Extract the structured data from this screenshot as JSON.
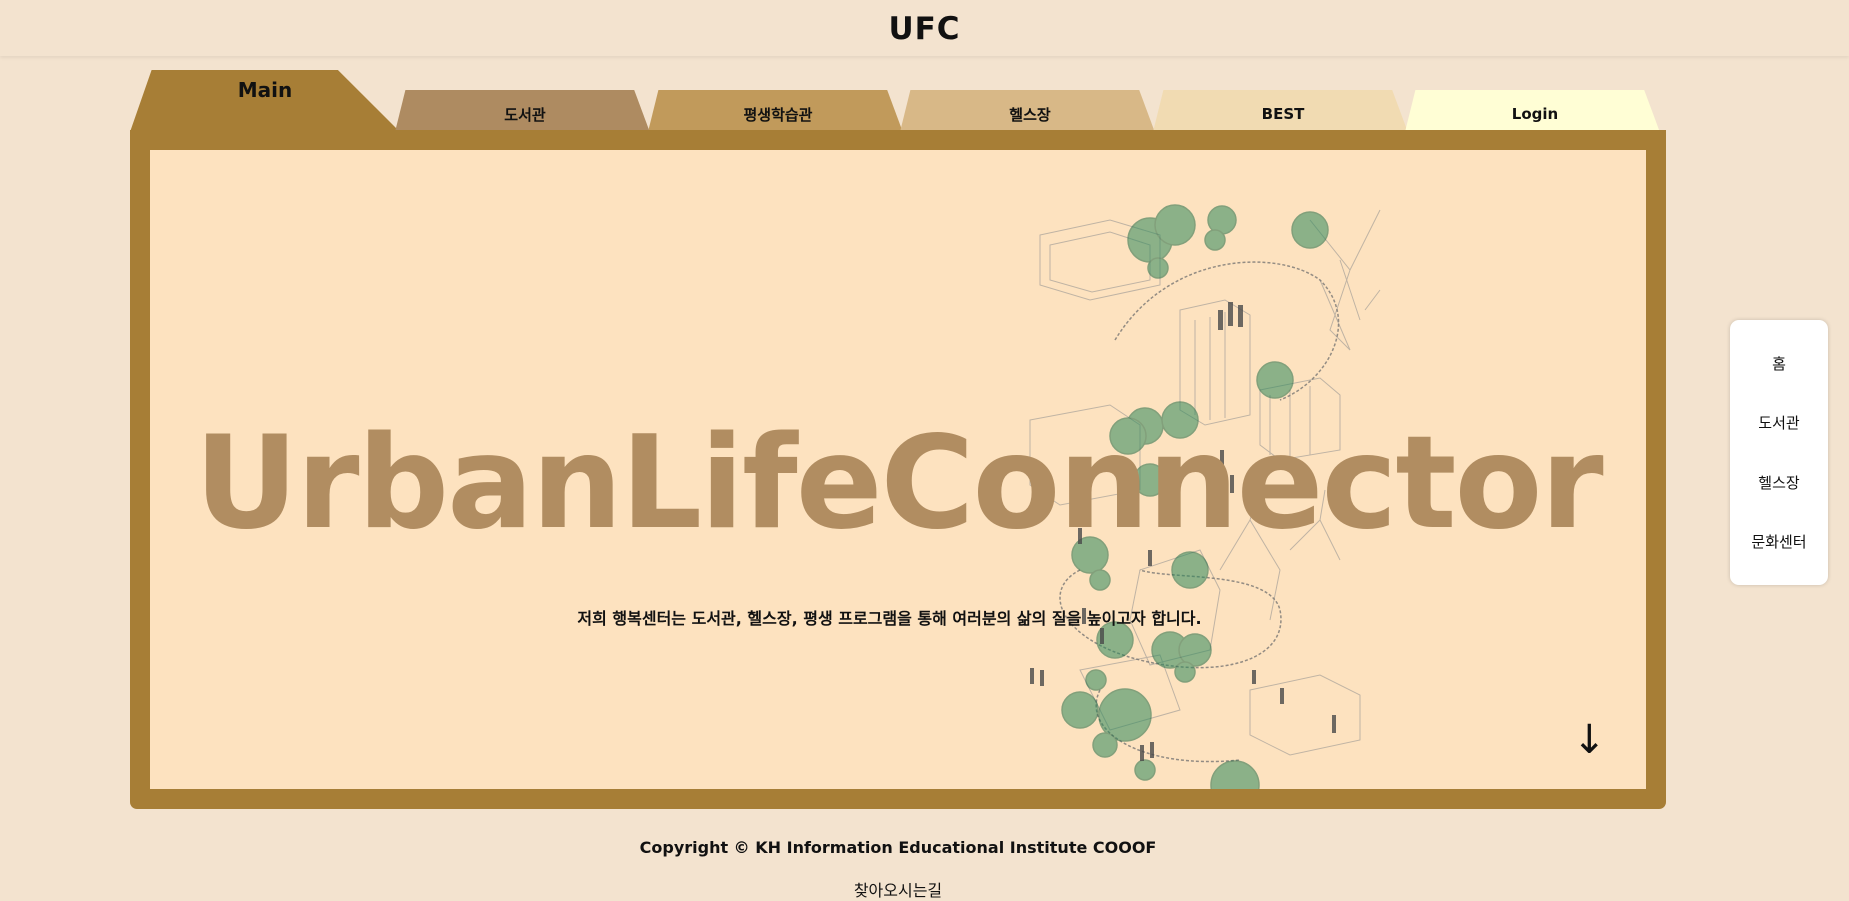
{
  "header": {
    "title": "UFC"
  },
  "tabs": [
    {
      "label": "Main",
      "color": "#a77e36"
    },
    {
      "label": "도서관",
      "color": "#ae8b61"
    },
    {
      "label": "평생학습관",
      "color": "#c19a5b"
    },
    {
      "label": "헬스장",
      "color": "#d8b887"
    },
    {
      "label": "BEST",
      "color": "#f1dbb2"
    },
    {
      "label": "Login",
      "color": "#fffed5"
    }
  ],
  "hero": {
    "title": "UrbanLifeConnector",
    "subtitle": "저희 행복센터는 도서관, 헬스장, 평생 프로그램을 통해 여러분의 삶의 질을 높이고자 합니다.",
    "scroll_arrow": "↓"
  },
  "sidenav": {
    "items": [
      {
        "label": "홈"
      },
      {
        "label": "도서관"
      },
      {
        "label": "헬스장"
      },
      {
        "label": "문화센터"
      }
    ]
  },
  "footer": {
    "copyright": "Copyright © KH Information Educational Institute COOOF",
    "directions": "찾아오시는길"
  },
  "colors": {
    "background": "#f3e3cf",
    "frame": "#a77e36",
    "panel": "#fde2bf",
    "hero_text": "#b18d61",
    "tree_green": "#2f8a5c"
  }
}
